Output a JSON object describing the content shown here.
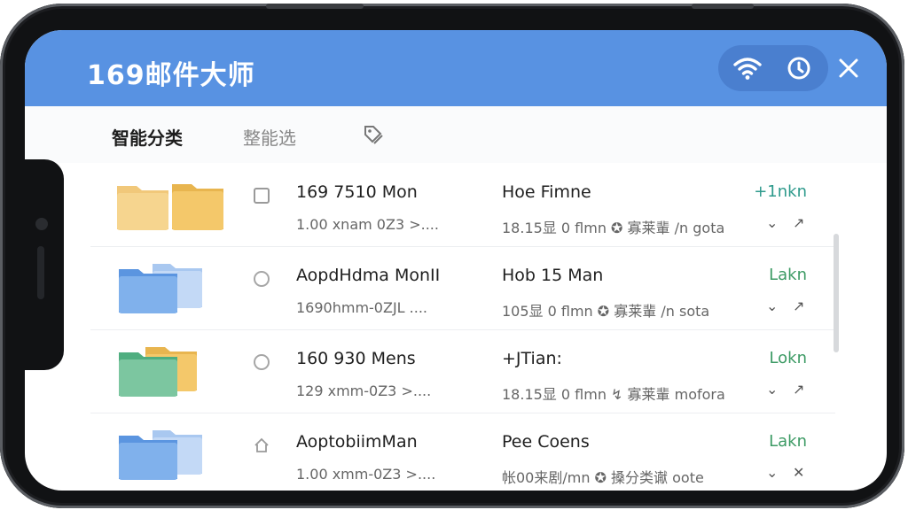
{
  "header": {
    "title": "169邮件大师",
    "icons": [
      "wifi-icon",
      "refresh-icon",
      "close-icon"
    ],
    "color": "#5892e2"
  },
  "tabs": [
    {
      "label": "智能分类",
      "active": true
    },
    {
      "label": "整能选",
      "active": false
    }
  ],
  "rows": [
    {
      "name": "169 7510 Mon",
      "subtitle": "1.00 xnam 0Z3 >....",
      "col2": "Hoe Fimne",
      "meta": "18.15显 0 flmn ✪ 寡莱輩 /n gota",
      "status": "+1nkn",
      "folder_colors": [
        "#f4c86a",
        "#f4c86a"
      ],
      "select": "box"
    },
    {
      "name": "AopdHdma MonII",
      "subtitle": "1690hmm-0ZJL  ....",
      "col2": "Hob 15 Man",
      "meta": "105显 0 flmn ✪ 寡莱輩 /n sota",
      "status": "Lakn",
      "folder_colors": [
        "#73a6e6",
        "#a9c8f0"
      ],
      "select": "circle"
    },
    {
      "name": "160 930 Mens",
      "subtitle": "129 xmm-0Z3 >....",
      "col2": "+JTian:",
      "meta": "18.15显 0 flmn ↯ 寡莱輩 mofora",
      "status": "Lokn",
      "folder_colors": [
        "#6bbf95",
        "#f4c86a"
      ],
      "select": "circle"
    },
    {
      "name": "AoptobiimMan",
      "subtitle": "1.00 xmm-0Z3 >....",
      "col2": "Pee Coens",
      "meta": "帐00来剧/mn ✪ 搡分类谳 oote",
      "status": "Lakn",
      "folder_colors": [
        "#73a6e6",
        "#a9c8f0"
      ],
      "select": "home"
    }
  ]
}
